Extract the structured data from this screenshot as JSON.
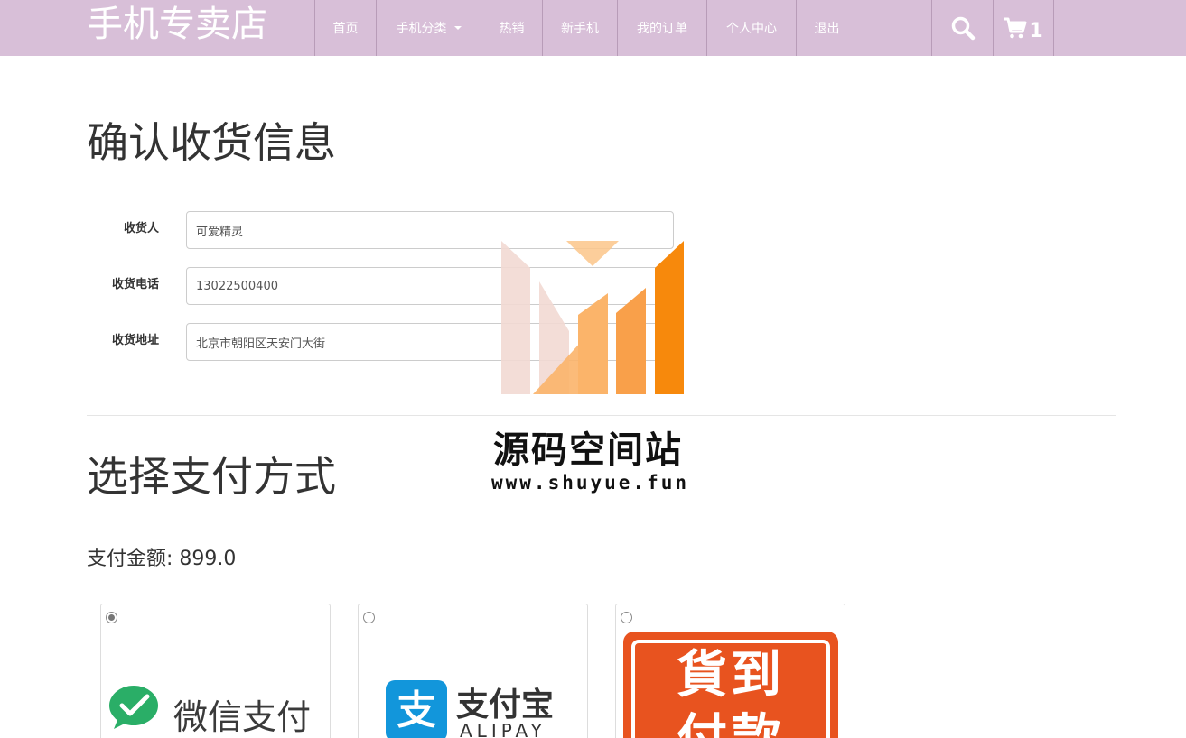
{
  "brand": "手机专卖店",
  "nav": {
    "items": [
      {
        "label": "首页"
      },
      {
        "label": "手机分类"
      },
      {
        "label": "热销"
      },
      {
        "label": "新手机"
      },
      {
        "label": "我的订单"
      },
      {
        "label": "个人中心"
      },
      {
        "label": "退出"
      }
    ],
    "cart_count": "1",
    "search_icon": "search-icon",
    "cart_icon": "cart-icon"
  },
  "shipping": {
    "title": "确认收货信息",
    "receiver_label": "收货人",
    "receiver_value": "可爱精灵",
    "phone_label": "收货电话",
    "phone_value": "13022500400",
    "address_label": "收货地址",
    "address_value": "北京市朝阳区天安门大街"
  },
  "payment": {
    "title": "选择支付方式",
    "amount_text": "支付金额: 899.0",
    "methods": [
      {
        "text": "微信支付",
        "selected": true,
        "color": "#2aae67"
      },
      {
        "text": "支付宝",
        "sub": "ALIPAY",
        "selected": false,
        "color": "#1296db"
      },
      {
        "text": "貨到",
        "text2": "付款",
        "selected": false,
        "color": "#e8531f"
      }
    ]
  },
  "watermark": {
    "title": "源码空间站",
    "url": "www.shuyue.fun",
    "colors": [
      "#f2d9d3",
      "#fbb46a",
      "#f7890c"
    ]
  }
}
